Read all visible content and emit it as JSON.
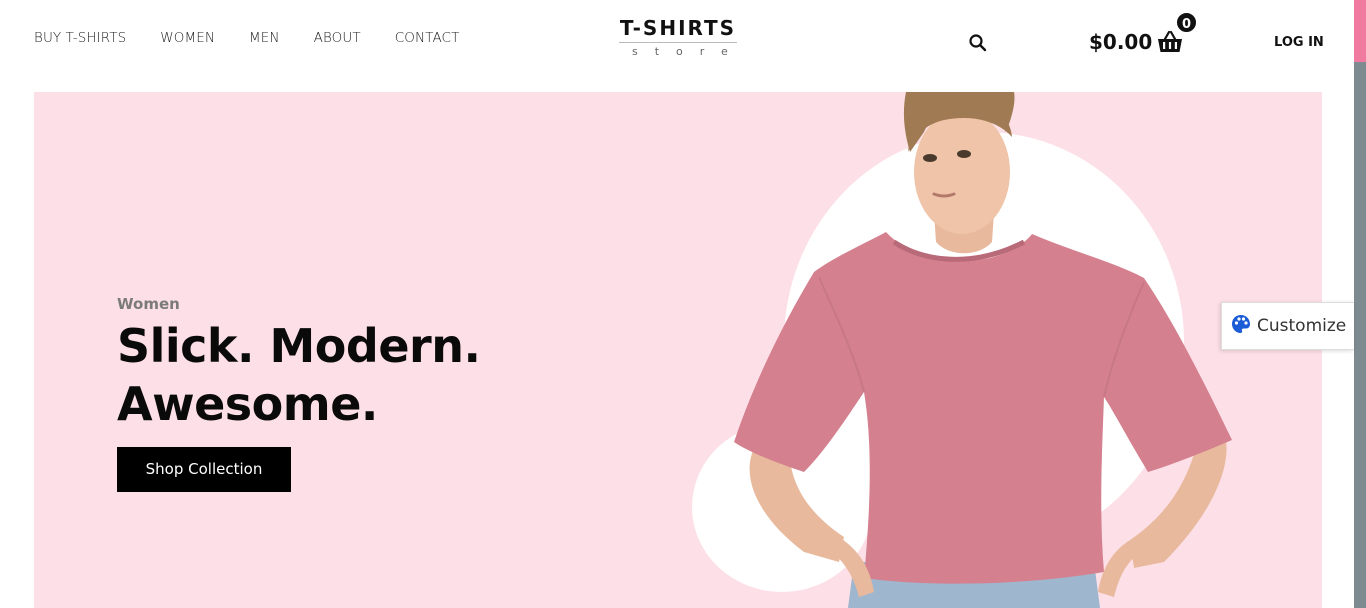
{
  "nav": {
    "items": [
      {
        "label": "BUY T-SHIRTS"
      },
      {
        "label": "WOMEN"
      },
      {
        "label": "MEN"
      },
      {
        "label": "ABOUT"
      },
      {
        "label": "CONTACT"
      }
    ]
  },
  "logo": {
    "title": "T-SHIRTS",
    "subtitle": "store"
  },
  "header": {
    "search_icon": "search-icon",
    "cart_total": "$0.00",
    "cart_icon": "basket-icon",
    "cart_count": "0",
    "login_label": "LOG IN"
  },
  "hero": {
    "label": "Women",
    "title_line1": "Slick. Modern.",
    "title_line2": "Awesome.",
    "button_label": "Shop Collection",
    "background_color": "#fddfe7",
    "shirt_color": "#d4808f"
  },
  "customize": {
    "label": "Customize",
    "icon": "palette-icon",
    "icon_color": "#1a5bd6"
  }
}
